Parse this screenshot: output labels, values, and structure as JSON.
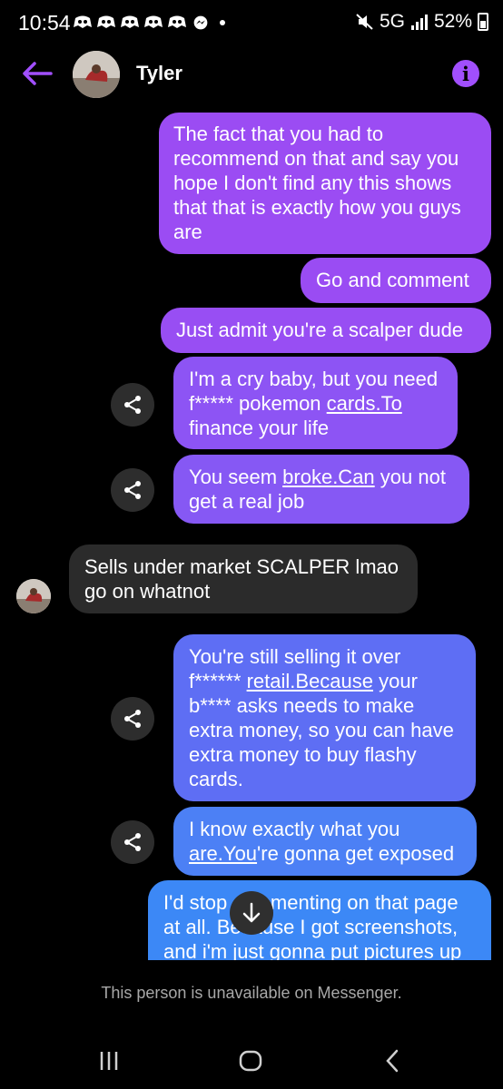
{
  "status": {
    "time": "10:54",
    "network": "5G",
    "battery": "52%"
  },
  "header": {
    "contact_name": "Tyler",
    "back_icon": "arrow-left-icon",
    "info_icon": "info-icon"
  },
  "colors": {
    "accent": "#a14ffd",
    "bubble_purple": "#9a4bf2",
    "bubble_blue": "#3c86f5",
    "incoming_bubble": "#2b2b2b"
  },
  "messages": [
    {
      "direction": "out",
      "lines": [
        "The fact that you had to",
        "recommend on that and say you",
        "hope I don't find any this shows",
        "that that is exactly how you guys",
        "are"
      ]
    },
    {
      "direction": "out",
      "lines": [
        "Go and comment"
      ]
    },
    {
      "direction": "out",
      "lines": [
        "Just admit you're a scalper dude"
      ]
    },
    {
      "direction": "out",
      "lines": [
        "I'm a cry baby, but you need",
        "f***** pokemon cards.To",
        "finance your life"
      ]
    },
    {
      "direction": "out",
      "lines": [
        "You seem broke.Can you not",
        "get a real job"
      ]
    },
    {
      "direction": "in",
      "lines": [
        "Sells under market SCALPER lmao",
        "go on whatnot"
      ]
    },
    {
      "direction": "out",
      "lines": [
        "You're still selling it over",
        "f****** retail.Because your",
        "b**** asks needs to make",
        "extra money, so you can have",
        "extra money to buy flashy",
        "cards."
      ]
    },
    {
      "direction": "out",
      "lines": [
        "I know exactly what you",
        "are.You're gonna get exposed"
      ]
    },
    {
      "direction": "out",
      "lines": [
        "I'd stop commenting on that page",
        "at all. Because I got screenshots,",
        "and i'm just gonna put pictures up"
      ]
    }
  ],
  "footer": {
    "note": "This person is unavailable on Messenger."
  },
  "nav": {
    "recents_icon": "recents-icon",
    "home_icon": "home-icon",
    "back_icon": "back-chevron-icon"
  }
}
